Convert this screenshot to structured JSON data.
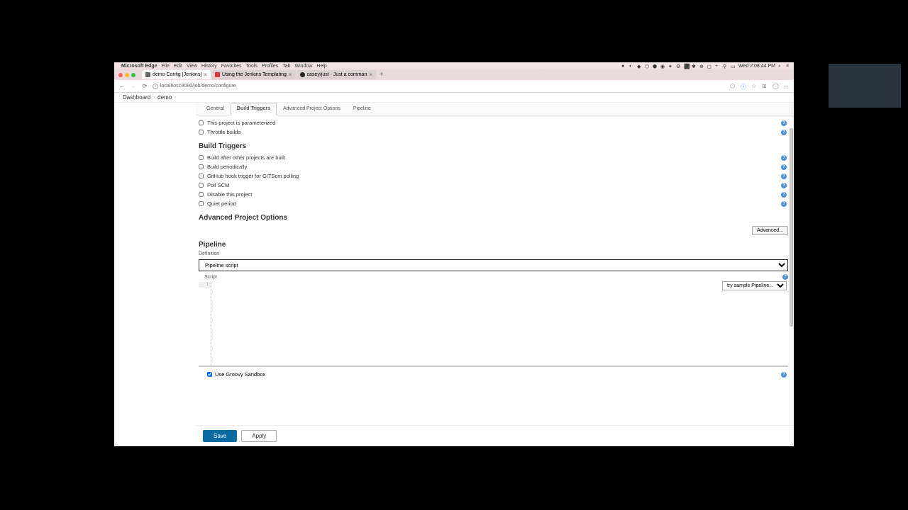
{
  "menubar": {
    "app": "Microsoft Edge",
    "items": [
      "File",
      "Edit",
      "View",
      "History",
      "Favorites",
      "Tools",
      "Profiles",
      "Tab",
      "Window",
      "Help"
    ],
    "clock": "Wed 2:08:44 PM"
  },
  "tabs": [
    {
      "title": "demo Config [Jenkins]",
      "active": true
    },
    {
      "title": "Using the Jenkins Templating",
      "active": false
    },
    {
      "title": "casey/just · Just a comman",
      "active": false
    }
  ],
  "addressbar": {
    "url": "localhost:8080/job/demo/configure"
  },
  "breadcrumb": {
    "items": [
      "Dashboard",
      "demo"
    ]
  },
  "config_tabs": {
    "items": [
      "General",
      "Build Triggers",
      "Advanced Project Options",
      "Pipeline"
    ],
    "active": "Build Triggers"
  },
  "general_options": [
    {
      "label": "This project is parameterized",
      "checked": false,
      "help": true
    },
    {
      "label": "Throttle builds",
      "checked": false,
      "help": true
    }
  ],
  "sections": {
    "build_triggers": {
      "title": "Build Triggers",
      "options": [
        {
          "label": "Build after other projects are built",
          "checked": false
        },
        {
          "label": "Build periodically",
          "checked": false
        },
        {
          "label": "GitHub hook trigger for GITScm polling",
          "checked": false
        },
        {
          "label": "Poll SCM",
          "checked": false
        },
        {
          "label": "Disable this project",
          "checked": false
        },
        {
          "label": "Quiet period",
          "checked": false
        }
      ]
    },
    "advanced": {
      "title": "Advanced Project Options",
      "button": "Advanced..."
    },
    "pipeline": {
      "title": "Pipeline",
      "definition_label": "Definition",
      "definition_value": "Pipeline script",
      "script_label": "Script",
      "sample_dropdown": "try sample Pipeline...",
      "line_number": "1",
      "sandbox_label": "Use Groovy Sandbox",
      "sandbox_checked": true
    }
  },
  "buttons": {
    "save": "Save",
    "apply": "Apply"
  }
}
